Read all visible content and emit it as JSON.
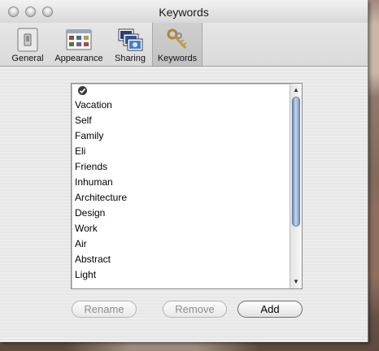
{
  "window": {
    "title": "Keywords"
  },
  "toolbar": {
    "items": [
      {
        "label": "General",
        "icon": "light-switch-icon"
      },
      {
        "label": "Appearance",
        "icon": "appearance-panel-icon"
      },
      {
        "label": "Sharing",
        "icon": "shared-photos-icon"
      },
      {
        "label": "Keywords",
        "icon": "keys-icon",
        "selected": true
      }
    ]
  },
  "keywords": {
    "items": [
      {
        "label": "",
        "icon": "checkmark-icon"
      },
      {
        "label": "Vacation"
      },
      {
        "label": "Self"
      },
      {
        "label": "Family"
      },
      {
        "label": "Eli"
      },
      {
        "label": "Friends"
      },
      {
        "label": "Inhuman"
      },
      {
        "label": "Architecture"
      },
      {
        "label": "Design"
      },
      {
        "label": "Work"
      },
      {
        "label": "Air"
      },
      {
        "label": "Abstract"
      },
      {
        "label": "Light"
      }
    ]
  },
  "buttons": {
    "rename_label": "Rename",
    "remove_label": "Remove",
    "add_label": "Add"
  }
}
